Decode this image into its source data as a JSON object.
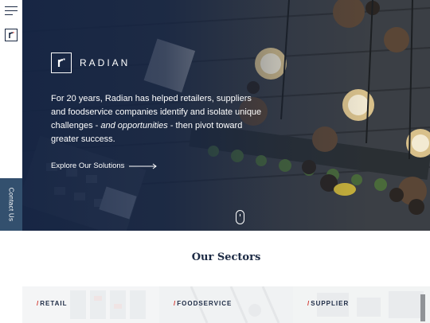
{
  "nav": {
    "menu_icon": "hamburger-icon",
    "logo_icon": "radian-logo-icon",
    "contact_label": "Contact Us"
  },
  "hero": {
    "brand_name": "RADIAN",
    "text_part1": "For 20 years, Radian has helped retailers, suppliers and foodservice companies identify and isolate unique challenges - ",
    "text_emphasis": "and opportunities",
    "text_part2": " - then pivot toward greater success.",
    "cta_label": "Explore Our Solutions",
    "scroll_icon": "scroll-mouse-icon"
  },
  "sectors": {
    "title": "Our Sectors",
    "items": [
      {
        "label": "RETAIL"
      },
      {
        "label": "FOODSERVICE"
      },
      {
        "label": "SUPPLIER"
      }
    ]
  },
  "colors": {
    "navy": "#1c2a44",
    "contact_tab": "#33506e",
    "accent_red": "#d0342c"
  }
}
